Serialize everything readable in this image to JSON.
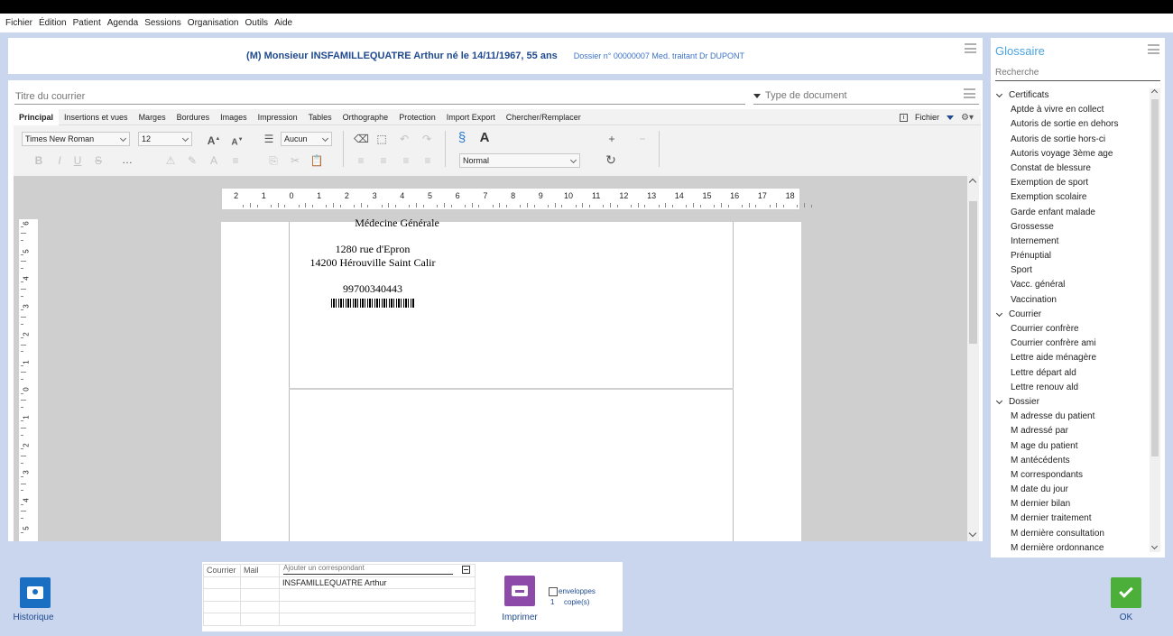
{
  "menu": [
    "Fichier",
    "Édition",
    "Patient",
    "Agenda",
    "Sessions",
    "Organisation",
    "Outils",
    "Aide"
  ],
  "patient": {
    "name": "(M) Monsieur INSFAMILLEQUATRE Arthur né le 14/11/1967, 55 ans",
    "dossier": "Dossier n° 00000007 Med. traitant Dr DUPONT"
  },
  "editor": {
    "title_placeholder": "Titre du courrier",
    "doctype_placeholder": "Type de document",
    "tabs": [
      "Principal",
      "Insertions et vues",
      "Marges",
      "Bordures",
      "Images",
      "Impression",
      "Tables",
      "Orthographe",
      "Protection",
      "Import Export",
      "Chercher/Remplacer"
    ],
    "file_menu": "Fichier",
    "font_family": "Times New Roman",
    "font_size": "12",
    "list_style": "Aucun",
    "paragraph_style": "Normal",
    "ruler_numbers": [
      "2",
      "1",
      "0",
      "1",
      "2",
      "3",
      "4",
      "5",
      "6",
      "7",
      "8",
      "9",
      "10",
      "11",
      "12",
      "13",
      "14",
      "15",
      "16",
      "17",
      "18"
    ],
    "vruler_numbers": [
      "6",
      "5",
      "4",
      "3",
      "2",
      "1",
      "0",
      "1",
      "2",
      "3",
      "4",
      "5"
    ],
    "document": {
      "line_partial": "Médecine Générale",
      "street": "1280 rue d'Epron",
      "city": "14200 Hérouville Saint Calir",
      "number": "99700340443"
    }
  },
  "glossary": {
    "title": "Glossaire",
    "search_placeholder": "Recherche",
    "categories": [
      {
        "name": "Certificats",
        "items": [
          "Aptde à vivre en collect",
          "Autoris de sortie en dehors",
          "Autoris de sortie hors-ci",
          "Autoris voyage 3ème age",
          "Constat de blessure",
          "Exemption de sport",
          "Exemption scolaire",
          "Garde enfant malade",
          "Grossesse",
          "Internement",
          "Prénuptial",
          "Sport",
          "Vacc. général",
          "Vaccination"
        ]
      },
      {
        "name": "Courrier",
        "items": [
          "Courrier confrère",
          "Courrier confrère ami",
          "Lettre aide ménagère",
          "Lettre départ ald",
          "Lettre renouv ald"
        ]
      },
      {
        "name": "Dossier",
        "items": [
          "M adresse du patient",
          "M adressé par",
          "M age du patient",
          "M antécédents",
          "M correspondants",
          "M date du jour",
          "M dernier bilan",
          "M dernier traitement",
          "M dernière consultation",
          "M dernière ordonnance"
        ]
      }
    ]
  },
  "bottom": {
    "history_label": "Historique",
    "print_label": "Imprimer",
    "ok_label": "OK",
    "col_courrier": "Courrier",
    "col_mail": "Mail",
    "add_placeholder": "Ajouter un correspondant",
    "correspondant": "INSFAMILLEQUATRE Arthur",
    "envelopes_label": "enveloppes",
    "copies_count": "1",
    "copies_label": "copie(s)"
  },
  "colors": {
    "accent": "#1f4a8f",
    "print": "#8e4aa8",
    "ok": "#4caf3a",
    "history": "#1b6fc2"
  }
}
